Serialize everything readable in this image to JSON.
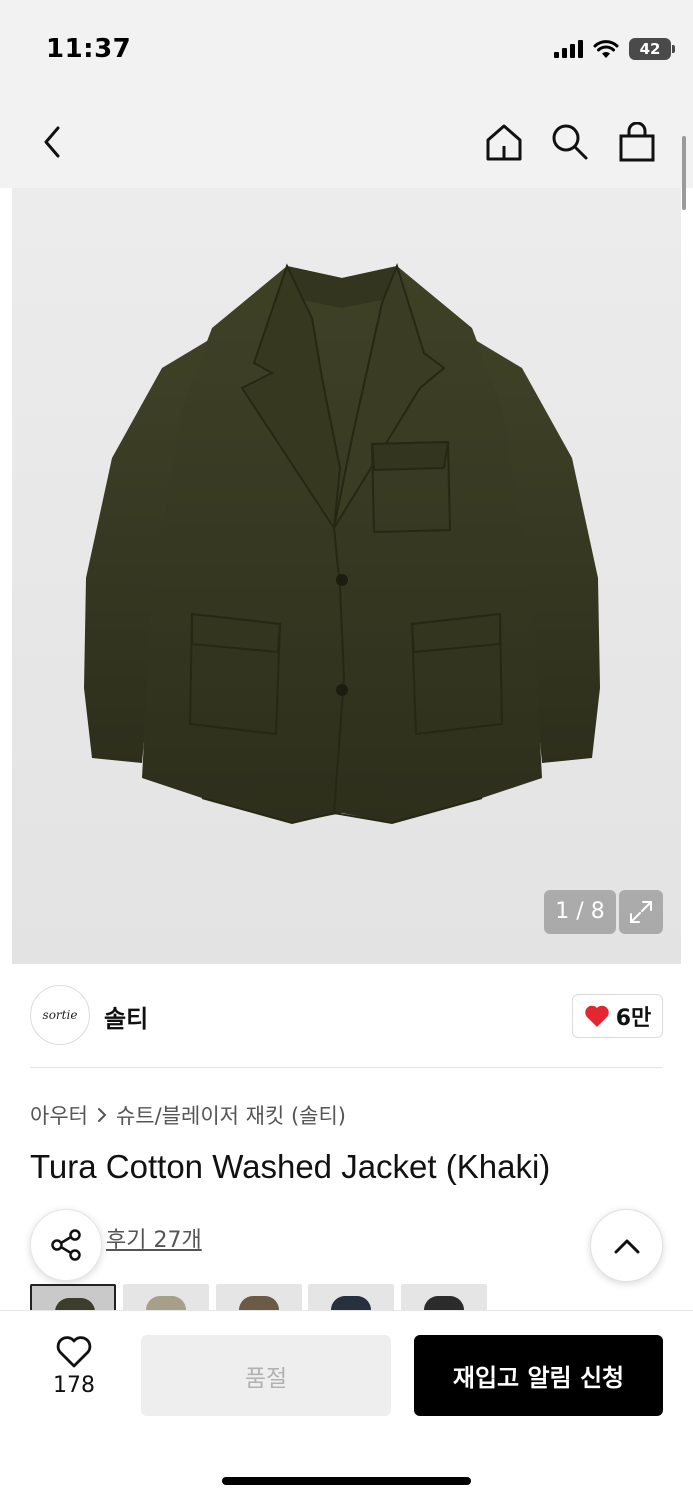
{
  "status_bar": {
    "time": "11:37",
    "battery": "42"
  },
  "nav": {
    "back_icon": "chevron-left-icon",
    "home_icon": "home-icon",
    "search_icon": "search-icon",
    "cart_icon": "shopping-bag-icon"
  },
  "gallery": {
    "counter": "1 / 8",
    "current": 1,
    "total": 8,
    "expand_icon": "expand-icon"
  },
  "brand": {
    "logo_text": "sortie",
    "name": "솔티",
    "likes": "6만",
    "heart_color": "#e3262f"
  },
  "breadcrumb": {
    "items": [
      "아우터",
      "슈트/블레이저 재킷 (솔티)"
    ]
  },
  "product": {
    "title": "Tura Cotton Washed Jacket (Khaki)"
  },
  "reviews": {
    "label": "후기 27개"
  },
  "swatches": [
    {
      "color": "#3d3d2c",
      "selected": true
    },
    {
      "color": "#a6a08a",
      "selected": false
    },
    {
      "color": "#6b5a46",
      "selected": false
    },
    {
      "color": "#27303f",
      "selected": false
    },
    {
      "color": "#2b2b2b",
      "selected": false
    }
  ],
  "bottom_bar": {
    "wish_count": "178",
    "soldout_label": "품절",
    "restock_label": "재입고 알림 신청"
  }
}
